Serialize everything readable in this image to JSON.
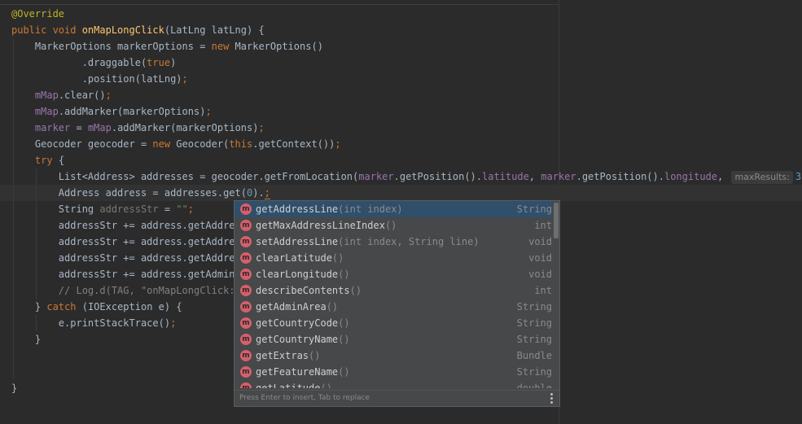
{
  "code_lines": [
    [
      {
        "t": "@Override",
        "c": "ann"
      }
    ],
    [
      {
        "t": "public void ",
        "c": "kw"
      },
      {
        "t": "onMapLongClick",
        "c": "fn"
      },
      {
        "t": "(LatLng latLng) {"
      }
    ],
    [
      {
        "t": "    MarkerOptions markerOptions = "
      },
      {
        "t": "new ",
        "c": "kw"
      },
      {
        "t": "MarkerOptions()"
      }
    ],
    [
      {
        "t": "            .draggable("
      },
      {
        "t": "true",
        "c": "kw"
      },
      {
        "t": ")"
      }
    ],
    [
      {
        "t": "            .position(latLng)"
      },
      {
        "t": ";",
        "c": "kw"
      }
    ],
    [
      {
        "t": "    "
      },
      {
        "t": "mMap",
        "c": "field"
      },
      {
        "t": ".clear()"
      },
      {
        "t": ";",
        "c": "kw"
      }
    ],
    [
      {
        "t": "    "
      },
      {
        "t": "mMap",
        "c": "field"
      },
      {
        "t": ".addMarker(markerOptions)"
      },
      {
        "t": ";",
        "c": "kw"
      }
    ],
    [
      {
        "t": "    "
      },
      {
        "t": "marker",
        "c": "field"
      },
      {
        "t": " = "
      },
      {
        "t": "mMap",
        "c": "field"
      },
      {
        "t": ".addMarker(markerOptions)"
      },
      {
        "t": ";",
        "c": "kw"
      }
    ],
    [
      {
        "t": "    Geocoder geocoder = "
      },
      {
        "t": "new ",
        "c": "kw"
      },
      {
        "t": "Geocoder("
      },
      {
        "t": "this",
        "c": "kw"
      },
      {
        "t": ".getContext())"
      },
      {
        "t": ";",
        "c": "kw"
      }
    ],
    [
      {
        "t": "    "
      },
      {
        "t": "try ",
        "c": "kw"
      },
      {
        "t": "{"
      }
    ],
    [
      {
        "t": "        List<Address> addresses = geocoder.getFromLocation("
      },
      {
        "t": "marker",
        "c": "field"
      },
      {
        "t": ".getPosition()."
      },
      {
        "t": "latitude",
        "c": "field"
      },
      {
        "t": ", "
      },
      {
        "t": "marker",
        "c": "field"
      },
      {
        "t": ".getPosition()."
      },
      {
        "t": "longitude",
        "c": "field"
      },
      {
        "t": ", "
      },
      {
        "t": "maxResults:",
        "c": "hint"
      },
      {
        "t": "3",
        "c": "num"
      },
      {
        "t": ")"
      },
      {
        "t": ";",
        "c": "kw"
      }
    ],
    [
      {
        "t": "        Address address = addresses.get("
      },
      {
        "t": "0",
        "c": "num"
      },
      {
        "t": ")."
      },
      {
        "t": ";",
        "c": "cursor-mark"
      }
    ],
    [
      {
        "t": "        String "
      },
      {
        "t": "addressStr",
        "c": "dim"
      },
      {
        "t": " = "
      },
      {
        "t": "\"\"",
        "c": "str"
      },
      {
        "t": ";",
        "c": "kw"
      }
    ],
    [
      {
        "t": "        addressStr += address.getAddres"
      }
    ],
    [
      {
        "t": "        addressStr += address.getAddres"
      }
    ],
    [
      {
        "t": "        addressStr += address.getAddres"
      }
    ],
    [
      {
        "t": "        addressStr += address.getAdminA"
      }
    ],
    [
      {
        "t": "        // Log.d(TAG, \"onMapLongClick:",
        "c": "com"
      }
    ],
    [
      {
        "t": "    } "
      },
      {
        "t": "catch ",
        "c": "kw"
      },
      {
        "t": "(IOException e) {"
      }
    ],
    [
      {
        "t": "        e.printStackTrace()"
      },
      {
        "t": ";",
        "c": "kw"
      }
    ],
    [
      {
        "t": "    }"
      }
    ],
    [
      {
        "t": ""
      }
    ],
    [
      {
        "t": ""
      }
    ],
    [
      {
        "t": "}"
      }
    ]
  ],
  "completion": {
    "items": [
      {
        "icon": "m",
        "name": "getAddressLine",
        "params": "(int index)",
        "type": "String",
        "selected": true
      },
      {
        "icon": "m",
        "name": "getMaxAddressLineIndex",
        "params": "()",
        "type": "int"
      },
      {
        "icon": "m",
        "name": "setAddressLine",
        "params": "(int index, String line)",
        "type": "void"
      },
      {
        "icon": "m",
        "name": "clearLatitude",
        "params": "()",
        "type": "void"
      },
      {
        "icon": "m",
        "name": "clearLongitude",
        "params": "()",
        "type": "void"
      },
      {
        "icon": "m",
        "name": "describeContents",
        "params": "()",
        "type": "int"
      },
      {
        "icon": "m",
        "name": "getAdminArea",
        "params": "()",
        "type": "String"
      },
      {
        "icon": "m",
        "name": "getCountryCode",
        "params": "()",
        "type": "String"
      },
      {
        "icon": "m",
        "name": "getCountryName",
        "params": "()",
        "type": "String"
      },
      {
        "icon": "m",
        "name": "getExtras",
        "params": "()",
        "type": "Bundle"
      },
      {
        "icon": "m",
        "name": "getFeatureName",
        "params": "()",
        "type": "String"
      },
      {
        "icon": "m",
        "name": "getLatitude",
        "params": "()",
        "type": "double"
      }
    ],
    "footer": "Press Enter to insert, Tab to replace"
  },
  "colors": {
    "background": "#2b2b2b",
    "keyword": "#cc7832",
    "annotation": "#bbb529",
    "function": "#ffc66d",
    "field": "#9876aa",
    "number": "#6897bb",
    "string": "#6a8759",
    "method_icon": "#d65f6a"
  }
}
